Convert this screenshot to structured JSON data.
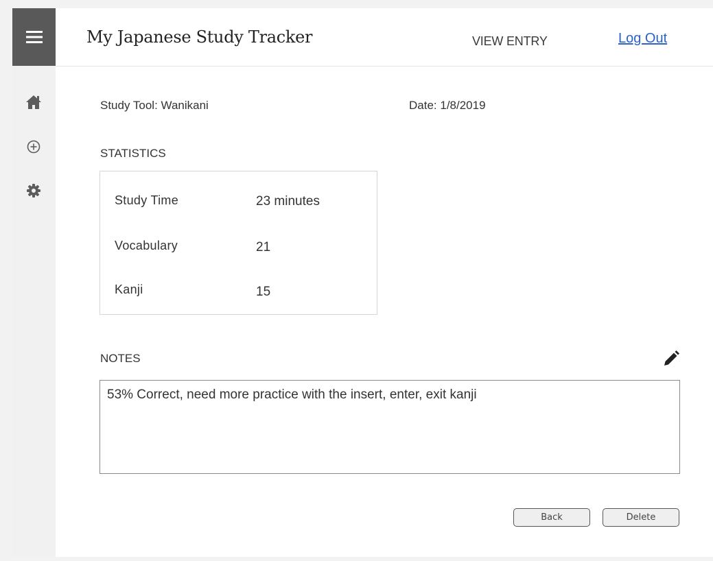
{
  "header": {
    "title": "My Japanese Study Tracker",
    "view_label": "VIEW ENTRY",
    "logout_label": "Log Out"
  },
  "sidebar": {
    "menu_icon": "hamburger-menu-icon",
    "items": [
      {
        "icon": "home-icon"
      },
      {
        "icon": "add-circle-icon"
      },
      {
        "icon": "gear-icon"
      }
    ]
  },
  "entry": {
    "study_tool_label": "Study Tool:",
    "study_tool_value": "Wanikani",
    "date_label": "Date:",
    "date_value": "1/8/2019"
  },
  "statistics": {
    "heading": "STATISTICS",
    "rows": [
      {
        "name": "Study Time",
        "value": "23 minutes"
      },
      {
        "name": "Vocabulary",
        "value": "21"
      },
      {
        "name": "Kanji",
        "value": "15"
      }
    ]
  },
  "notes": {
    "heading": "NOTES",
    "edit_icon": "pencil-icon",
    "text": "53% Correct, need more practice with the insert, enter, exit kanji"
  },
  "actions": {
    "back_label": "Back",
    "delete_label": "Delete"
  },
  "colors": {
    "rail_menu_bg": "#595959",
    "link": "#2a63c7",
    "icon": "#5c5c5c"
  }
}
